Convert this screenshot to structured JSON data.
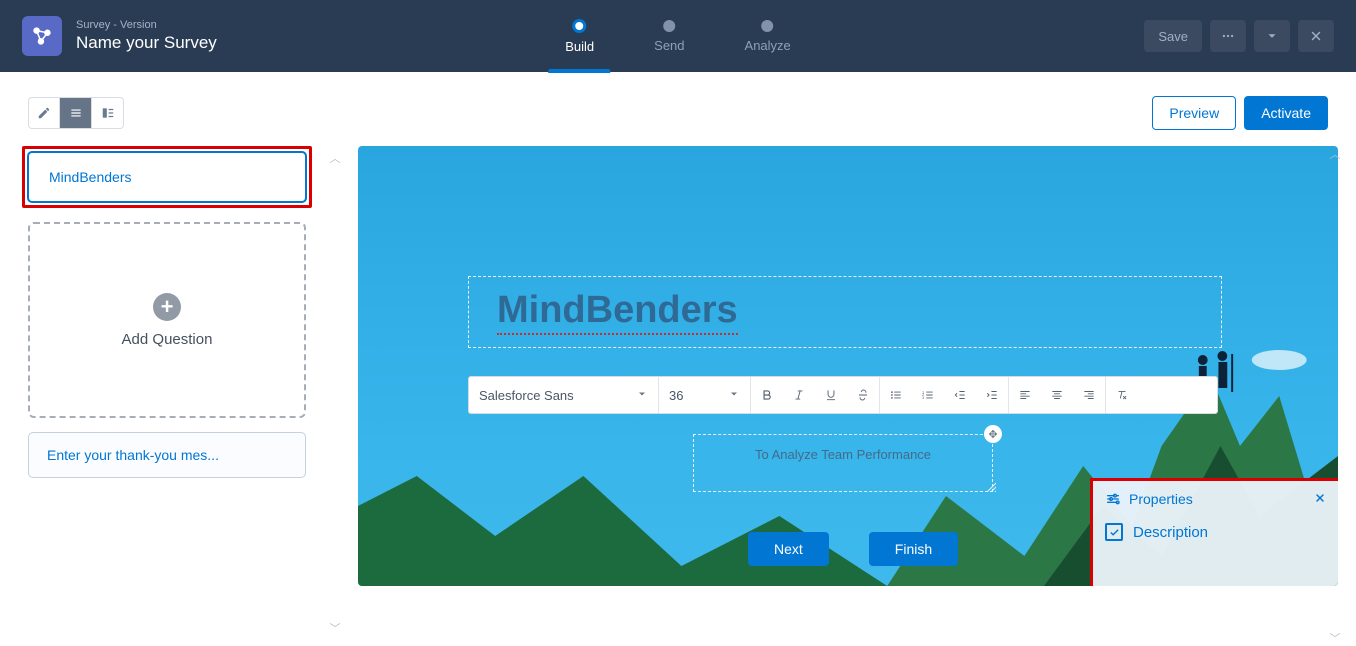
{
  "header": {
    "subtitle": "Survey - Version",
    "title": "Name your Survey",
    "tabs": [
      "Build",
      "Send",
      "Analyze"
    ],
    "active_tab": 0,
    "save_label": "Save"
  },
  "toolbar": {
    "preview_label": "Preview",
    "activate_label": "Activate"
  },
  "sidebar": {
    "page_card_label": "MindBenders",
    "add_question_label": "Add Question",
    "thank_you_label": "Enter your thank-you mes..."
  },
  "canvas": {
    "title_text": "MindBenders",
    "description_text": "To Analyze Team Performance",
    "next_label": "Next",
    "finish_label": "Finish"
  },
  "rte": {
    "font": "Salesforce Sans",
    "size": "36"
  },
  "properties": {
    "panel_title": "Properties",
    "description_label": "Description",
    "description_checked": true
  }
}
